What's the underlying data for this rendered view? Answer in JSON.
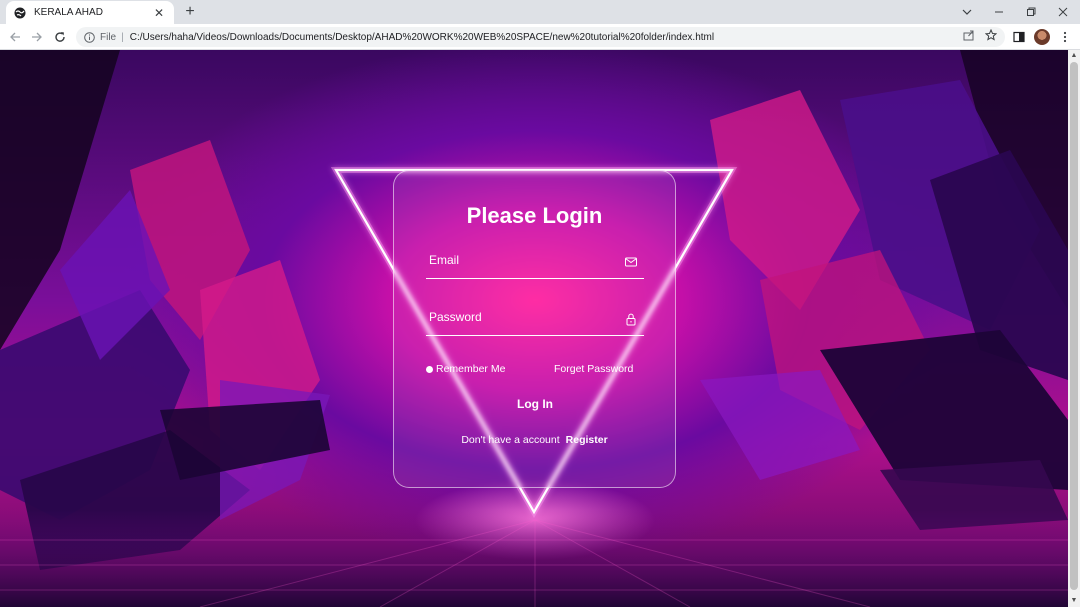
{
  "browser": {
    "tab_title": "KERALA AHAD",
    "file_label": "File",
    "url": "C:/Users/haha/Videos/Downloads/Documents/Desktop/AHAD%20WORK%20WEB%20SPACE/new%20tutorial%20folder/index.html",
    "separator": "|",
    "tab_close": "✕",
    "new_tab": "+"
  },
  "login": {
    "title": "Please Login",
    "email_label": "Email",
    "password_label": "Password",
    "remember_label": "Remember Me",
    "forget_label": "Forget Password",
    "login_button": "Log In",
    "no_account": "Don't have a account",
    "register_link": "Register"
  },
  "colors": {
    "accent": "#ff1e9e",
    "chrome_bg": "#dee1e6"
  }
}
